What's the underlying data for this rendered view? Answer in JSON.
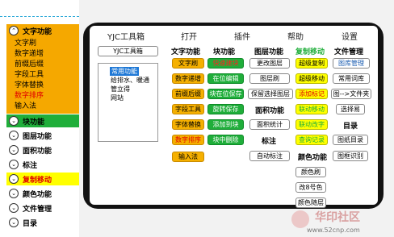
{
  "sidebar": {
    "sections": [
      {
        "title": "文字功能",
        "state": "expanded",
        "items": [
          "文字刷",
          "数字递增",
          "前缀后缀",
          "字段工具",
          "字体替换",
          "数字排序",
          "输入法"
        ],
        "active_item": "数字排序"
      },
      {
        "title": "块功能",
        "state": "highlight-green"
      },
      {
        "title": "图层功能",
        "state": "collapsed"
      },
      {
        "title": "面积功能",
        "state": "collapsed"
      },
      {
        "title": "标注",
        "state": "collapsed"
      },
      {
        "title": "复制移动",
        "state": "highlight-yellow"
      },
      {
        "title": "颜色功能",
        "state": "collapsed"
      },
      {
        "title": "文件管理",
        "state": "collapsed"
      },
      {
        "title": "目录",
        "state": "collapsed"
      }
    ]
  },
  "menu": [
    "YJC工具箱",
    "打开",
    "插件",
    "帮助",
    "设置"
  ],
  "toolbox_button": "YJC工具箱",
  "listbox_items": [
    "常用功能",
    "给排水、暖通",
    "管立得",
    "网站"
  ],
  "columns": {
    "text": {
      "head": "文字功能",
      "buttons": [
        "文字刷",
        "数字递增",
        "前缀后缀",
        "字段工具",
        "字体替换",
        "数字排序",
        "输入法"
      ]
    },
    "block": {
      "head": "块功能",
      "buttons": [
        "快速建块",
        "在位编辑",
        "块在位保存",
        "旋转保存",
        "添加到块",
        "块中删除"
      ]
    },
    "layer": {
      "head": "图层功能",
      "buttons": [
        "更改图层",
        "图层刷",
        "保留选择图层",
        "面积统计",
        "自动标注"
      ],
      "area_head": "面积功能",
      "label_head": "标注"
    },
    "copy": {
      "head": "复制移动",
      "buttons": [
        "超级复制",
        "超级移动",
        "添加标记",
        "联动移动",
        "联动改字",
        "查询记录",
        "颜色刷",
        "改8号色",
        "颜色随层"
      ],
      "color_head": "颜色功能"
    },
    "file": {
      "head": "文件管理",
      "buttons": [
        "图库管理",
        "常用词库",
        "图-->文件夹",
        "选择易",
        "图纸目录",
        "图框识别"
      ],
      "dir_head": "目录"
    }
  },
  "colors": {
    "accent_orange": "#f5a800",
    "accent_green": "#1fae3a",
    "accent_yellow": "#ffff00",
    "accent_red": "#e00000",
    "accent_blue": "#1a5cb0"
  },
  "watermark": {
    "brand": "华印社区",
    "url": "www.52cnp.com"
  }
}
